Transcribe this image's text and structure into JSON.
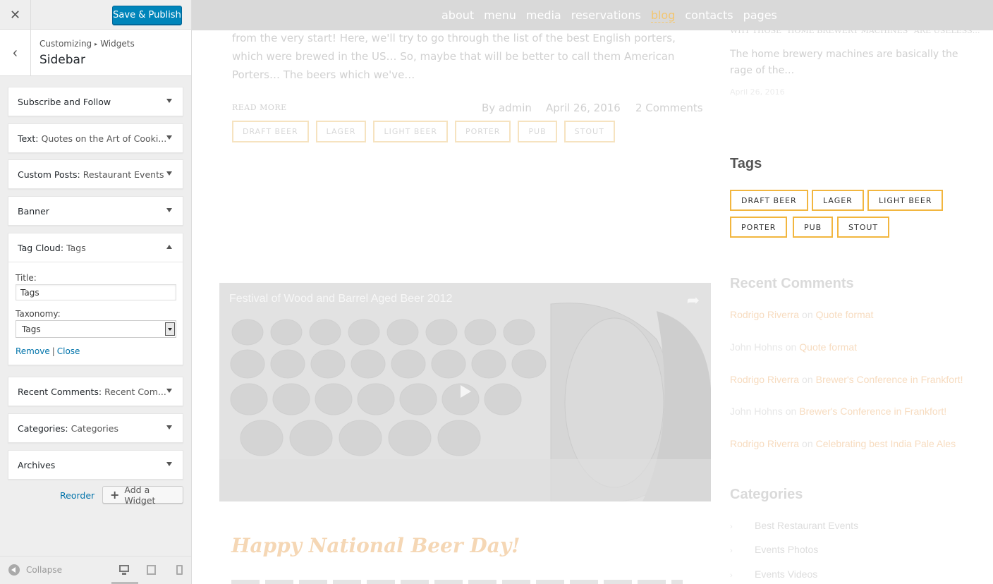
{
  "customizer": {
    "close_icon": "close-icon",
    "publish_label": "Save & Publish",
    "breadcrumb": {
      "part1": "Customizing",
      "separator": "▸",
      "part2": "Widgets"
    },
    "section_title": "Sidebar",
    "widgets": [
      {
        "name": "Subscribe and Follow",
        "sub": ""
      },
      {
        "name": "Text:",
        "sub": "Quotes on the Art of Cooki..."
      },
      {
        "name": "Custom Posts:",
        "sub": "Restaurant Events"
      },
      {
        "name": "Banner",
        "sub": ""
      },
      {
        "name": "Tag Cloud:",
        "sub": "Tags"
      },
      {
        "name": "Recent Comments:",
        "sub": "Recent Com..."
      },
      {
        "name": "Categories:",
        "sub": "Categories"
      },
      {
        "name": "Archives",
        "sub": ""
      }
    ],
    "tag_cloud_form": {
      "title_label": "Title:",
      "title_value": "Tags",
      "taxonomy_label": "Taxonomy:",
      "taxonomy_value": "Tags",
      "remove_label": "Remove",
      "pipe": "|",
      "close_label": "Close"
    },
    "reorder_label": "Reorder",
    "add_widget_label": "Add a Widget",
    "collapse_label": "Collapse"
  },
  "preview": {
    "nav": [
      "about",
      "menu",
      "media",
      "reservations",
      "blog",
      "contacts",
      "pages"
    ],
    "nav_active": "blog",
    "accent": "#f2b63f",
    "excerpt": "from the very start! Here, we'll try to go through the list of the best English porters, which were brewed in the US… So, maybe that will be better to call them American Porters… The beers which we've…",
    "read_more": "READ MORE",
    "meta_author": "By admin",
    "meta_date": "April 26, 2016",
    "meta_comments": "2 Comments",
    "post_tags": [
      "DRAFT BEER",
      "LAGER",
      "LIGHT BEER",
      "PORTER",
      "PUB",
      "STOUT"
    ],
    "right_post_title": "WHY THOSE \"HOME BREWERY MACHINES\" ARE USELESS…",
    "right_excerpt": "The home brewery machines are basically the rage of the…",
    "right_date": "April 26, 2016",
    "tags_title": "Tags",
    "tag_cloud": [
      "DRAFT BEER",
      "LAGER",
      "LIGHT BEER",
      "PORTER",
      "PUB",
      "STOUT"
    ],
    "recent_comments_title": "Recent Comments",
    "recent_comments": [
      {
        "author": "Rodrigo Riverra",
        "on": "on",
        "post": "Quote format"
      },
      {
        "author": "John Hohns",
        "on": "on",
        "post": "Quote format"
      },
      {
        "author": "Rodrigo Riverra",
        "on": "on",
        "post": "Brewer's Conference in Frankfort!"
      },
      {
        "author": "John Hohns",
        "on": "on",
        "post": "Brewer's Conference in Frankfort!"
      },
      {
        "author": "Rodrigo Riverra",
        "on": "on",
        "post": "Celebrating best India Pale Ales"
      }
    ],
    "video_title": "Festival of Wood and Barrel Aged Beer 2012",
    "categories_title": "Categories",
    "categories": [
      "Best Restaurant Events",
      "Events Photos",
      "Events Videos"
    ],
    "post_title": "Happy National Beer Day!"
  }
}
